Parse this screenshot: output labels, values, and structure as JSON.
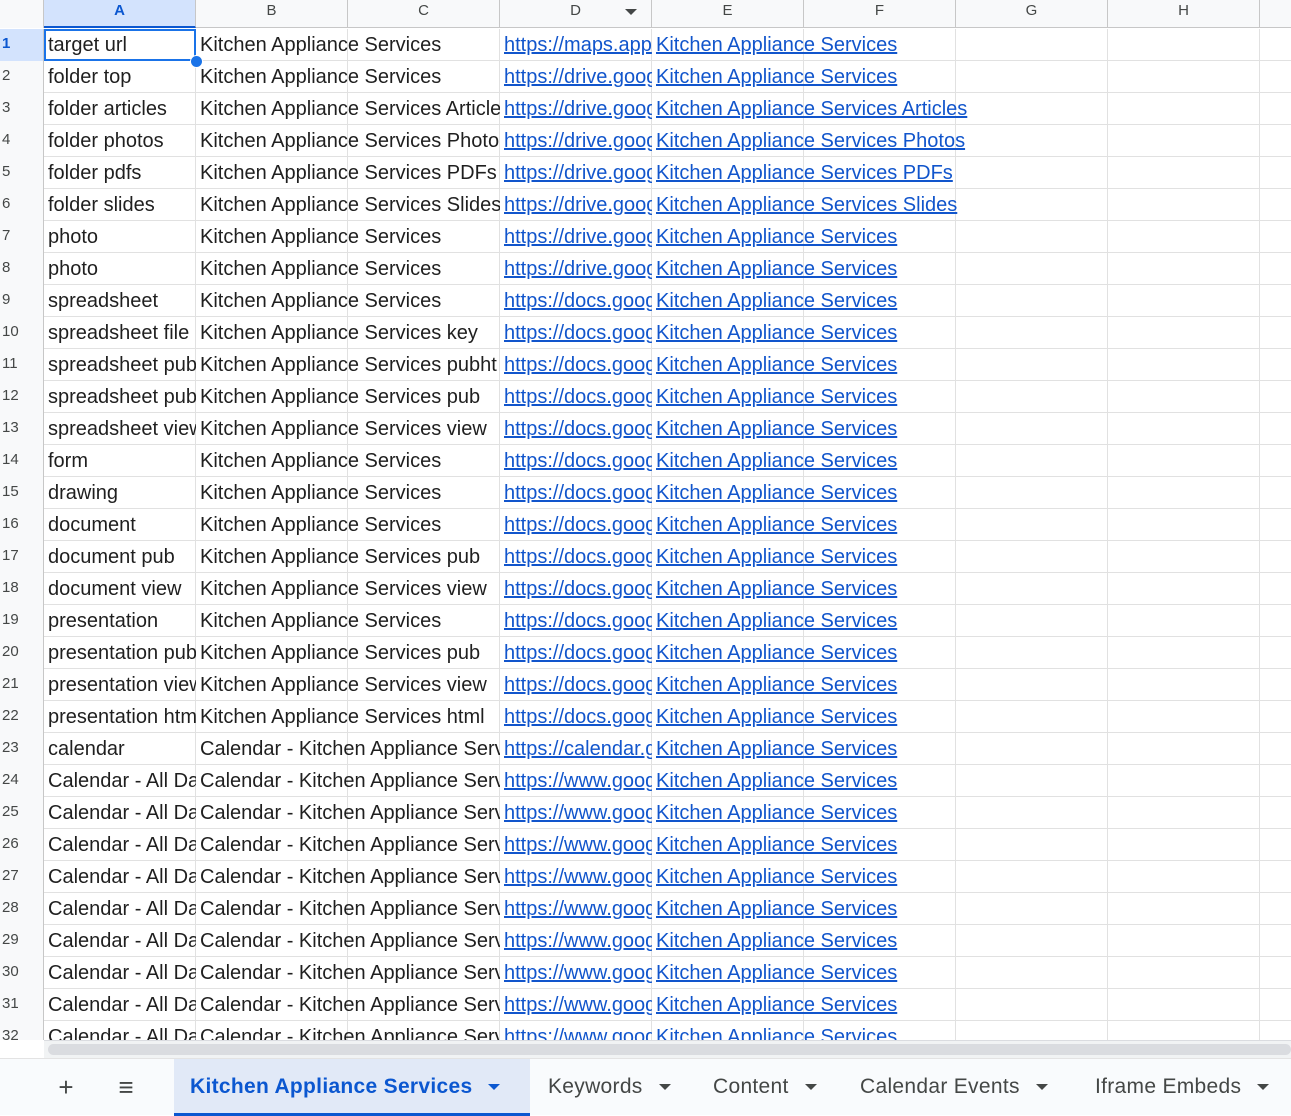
{
  "columns": [
    "A",
    "B",
    "C",
    "D",
    "E",
    "F",
    "G",
    "H"
  ],
  "rows": [
    {
      "n": "1",
      "a": "target url",
      "b": "Kitchen Appliance Services",
      "d": "https://maps.app",
      "e": "Kitchen Appliance Services"
    },
    {
      "n": "2",
      "a": "folder top",
      "b": "Kitchen Appliance Services",
      "d": "https://drive.goog",
      "e": "Kitchen Appliance Services"
    },
    {
      "n": "3",
      "a": "folder articles",
      "b": "Kitchen Appliance Services Article",
      "d": "https://drive.goog",
      "e": "Kitchen Appliance Services Articles"
    },
    {
      "n": "4",
      "a": "folder photos",
      "b": "Kitchen Appliance Services Photo",
      "d": "https://drive.goog",
      "e": "Kitchen Appliance Services Photos"
    },
    {
      "n": "5",
      "a": "folder pdfs",
      "b": "Kitchen Appliance Services PDFs",
      "d": "https://drive.goog",
      "e": "Kitchen Appliance Services PDFs"
    },
    {
      "n": "6",
      "a": "folder slides",
      "b": "Kitchen Appliance Services Slides",
      "d": "https://drive.goog",
      "e": "Kitchen Appliance Services Slides"
    },
    {
      "n": "7",
      "a": "photo",
      "b": "Kitchen Appliance Services",
      "d": "https://drive.goog",
      "e": "Kitchen Appliance Services"
    },
    {
      "n": "8",
      "a": "photo",
      "b": "Kitchen Appliance Services",
      "d": "https://drive.goog",
      "e": "Kitchen Appliance Services"
    },
    {
      "n": "9",
      "a": "spreadsheet",
      "b": "Kitchen Appliance Services",
      "d": "https://docs.goog",
      "e": "Kitchen Appliance Services"
    },
    {
      "n": "10",
      "a": "spreadsheet file",
      "b": "Kitchen Appliance Services key",
      "d": "https://docs.goog",
      "e": "Kitchen Appliance Services"
    },
    {
      "n": "11",
      "a": "spreadsheet pub",
      "b": "Kitchen Appliance Services pubht",
      "d": "https://docs.goog",
      "e": "Kitchen Appliance Services"
    },
    {
      "n": "12",
      "a": "spreadsheet pub",
      "b": "Kitchen Appliance Services pub",
      "d": "https://docs.goog",
      "e": "Kitchen Appliance Services"
    },
    {
      "n": "13",
      "a": "spreadsheet view",
      "b": "Kitchen Appliance Services view",
      "d": "https://docs.goog",
      "e": "Kitchen Appliance Services"
    },
    {
      "n": "14",
      "a": "form",
      "b": "Kitchen Appliance Services",
      "d": "https://docs.goog",
      "e": "Kitchen Appliance Services"
    },
    {
      "n": "15",
      "a": "drawing",
      "b": "Kitchen Appliance Services",
      "d": "https://docs.goog",
      "e": "Kitchen Appliance Services"
    },
    {
      "n": "16",
      "a": "document",
      "b": "Kitchen Appliance Services",
      "d": "https://docs.goog",
      "e": "Kitchen Appliance Services"
    },
    {
      "n": "17",
      "a": "document pub",
      "b": "Kitchen Appliance Services pub",
      "d": "https://docs.goog",
      "e": "Kitchen Appliance Services"
    },
    {
      "n": "18",
      "a": "document view",
      "b": "Kitchen Appliance Services view",
      "d": "https://docs.goog",
      "e": "Kitchen Appliance Services"
    },
    {
      "n": "19",
      "a": "presentation",
      "b": "Kitchen Appliance Services",
      "d": "https://docs.goog",
      "e": "Kitchen Appliance Services"
    },
    {
      "n": "20",
      "a": "presentation pub",
      "b": "Kitchen Appliance Services pub",
      "d": "https://docs.goog",
      "e": "Kitchen Appliance Services"
    },
    {
      "n": "21",
      "a": "presentation view",
      "b": "Kitchen Appliance Services view",
      "d": "https://docs.goog",
      "e": "Kitchen Appliance Services"
    },
    {
      "n": "22",
      "a": "presentation html",
      "b": "Kitchen Appliance Services html",
      "d": "https://docs.goog",
      "e": "Kitchen Appliance Services"
    },
    {
      "n": "23",
      "a": "calendar",
      "b": "Calendar - Kitchen Appliance Services",
      "d": "https://calendar.g",
      "e": "Kitchen Appliance Services"
    },
    {
      "n": "24",
      "a": "Calendar - All Day",
      "b": "Calendar - Kitchen Appliance Services",
      "d": "https://www.goog",
      "e": "Kitchen Appliance Services"
    },
    {
      "n": "25",
      "a": "Calendar - All Day",
      "b": "Calendar - Kitchen Appliance Services",
      "d": "https://www.goog",
      "e": "Kitchen Appliance Services"
    },
    {
      "n": "26",
      "a": "Calendar - All Day",
      "b": "Calendar - Kitchen Appliance Services",
      "d": "https://www.goog",
      "e": "Kitchen Appliance Services"
    },
    {
      "n": "27",
      "a": "Calendar - All Day",
      "b": "Calendar - Kitchen Appliance Services",
      "d": "https://www.goog",
      "e": "Kitchen Appliance Services"
    },
    {
      "n": "28",
      "a": "Calendar - All Day",
      "b": "Calendar - Kitchen Appliance Services",
      "d": "https://www.goog",
      "e": "Kitchen Appliance Services"
    },
    {
      "n": "29",
      "a": "Calendar - All Day",
      "b": "Calendar - Kitchen Appliance Services",
      "d": "https://www.goog",
      "e": "Kitchen Appliance Services"
    },
    {
      "n": "30",
      "a": "Calendar - All Day",
      "b": "Calendar - Kitchen Appliance Services",
      "d": "https://www.goog",
      "e": "Kitchen Appliance Services"
    },
    {
      "n": "31",
      "a": "Calendar - All Day",
      "b": "Calendar - Kitchen Appliance Services",
      "d": "https://www.goog",
      "e": "Kitchen Appliance Services"
    },
    {
      "n": "32",
      "a": "Calendar - All Day",
      "b": "Calendar - Kitchen Appliance Services",
      "d": "https://www.goog",
      "e": "Kitchen Appliance Services"
    }
  ],
  "toolbar": {
    "add_sheet_icon": "plus-icon",
    "all_sheets_icon": "menu-icon"
  },
  "tabs": [
    {
      "label": "Kitchen Appliance Services",
      "active": true
    },
    {
      "label": "Keywords",
      "active": false
    },
    {
      "label": "Content",
      "active": false
    },
    {
      "label": "Calendar Events",
      "active": false
    },
    {
      "label": "Iframe Embeds",
      "active": false
    }
  ],
  "colors": {
    "accent": "#0b57d0",
    "link": "#1155cc",
    "selection": "#d3e3fd"
  }
}
